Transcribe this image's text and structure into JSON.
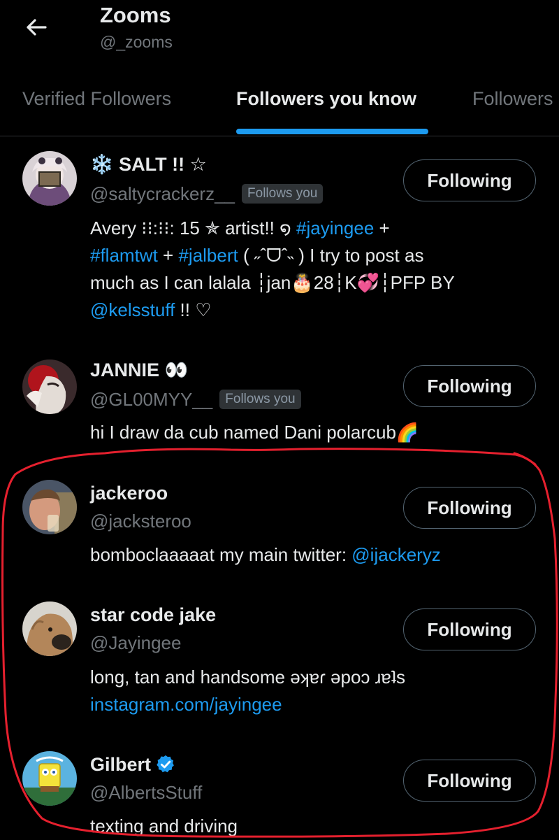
{
  "header": {
    "title": "Zooms",
    "handle": "@_zooms"
  },
  "tabs": [
    {
      "label": "Verified Followers"
    },
    {
      "label": "Followers you know"
    },
    {
      "label": "Followers"
    }
  ],
  "active_tab": "Followers you know",
  "follow_button_label": "Following",
  "follows_you_label": "Follows you",
  "users": [
    {
      "name": "❄️ SALT !! ☆",
      "handle": "@saltycrackerz__",
      "follows_you": true,
      "bio_lines": [
        [
          "Avery ⁝⁝:⁝⁝: 15 ✯ artist!! ໑ ",
          "#jayingee",
          " +"
        ],
        [
          "#flamtwt",
          " + ",
          "#jalbert",
          " ( ˶ˆᗜˆ˵ ) I try to post as"
        ],
        [
          "much as I can lalala ┆jan🎂28┆K💞┆PFP BY"
        ],
        [
          "@kelsstuff",
          " !! ♡"
        ]
      ]
    },
    {
      "name": "JANNIE 👀",
      "handle": "@GL00MYY__",
      "follows_you": true,
      "bio": "hi I draw da cub named Dani polarcub🌈"
    },
    {
      "name": "jackeroo",
      "handle": "@jacksteroo",
      "follows_you": false,
      "bio_text": "bomboclaaaaat my main twitter: ",
      "bio_link": "@ijackeryz"
    },
    {
      "name": "star code jake",
      "handle": "@Jayingee",
      "follows_you": false,
      "bio_text": "long, tan and handsome ǝʞɐɾ ǝpoɔ ɹɐʇs",
      "bio_link": "instagram.com/jayingee"
    },
    {
      "name": "Gilbert",
      "handle": "@AlbertsStuff",
      "verified": true,
      "follows_you": false,
      "bio": "texting and driving"
    }
  ],
  "colors": {
    "background": "#000000",
    "text": "#e7e9ea",
    "muted": "#71767b",
    "accent": "#1d9bf0",
    "annotation": "#e5202e"
  }
}
